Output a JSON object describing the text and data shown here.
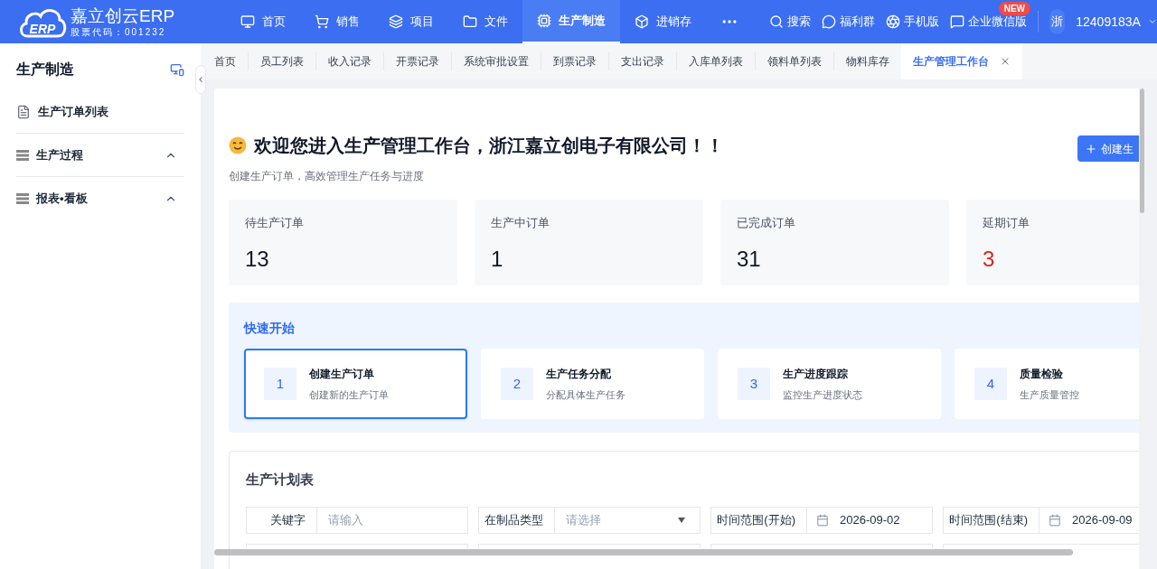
{
  "logo": {
    "mark": "ERP",
    "name": "嘉立创云ERP",
    "stock_code": "股票代码：001232"
  },
  "nav": [
    {
      "label": "首页",
      "selected": false
    },
    {
      "label": "销售",
      "selected": false
    },
    {
      "label": "项目",
      "selected": false
    },
    {
      "label": "文件",
      "selected": false
    },
    {
      "label": "生产制造",
      "selected": true
    },
    {
      "label": "进销存",
      "selected": false
    }
  ],
  "header_actions": [
    {
      "label": "搜索"
    },
    {
      "label": "福利群"
    },
    {
      "label": "手机版"
    },
    {
      "label": "企业微信版",
      "badge": "NEW"
    }
  ],
  "user": {
    "avatar": "浙",
    "account": "12409183A"
  },
  "sidebar": {
    "title": "生产制造",
    "items": [
      {
        "label": "生产订单列表",
        "kind": "link"
      },
      {
        "label": "生产过程",
        "kind": "group"
      },
      {
        "label": "报表•看板",
        "kind": "group"
      }
    ]
  },
  "tabs": [
    {
      "label": "首页",
      "selected": false
    },
    {
      "label": "员工列表",
      "selected": false
    },
    {
      "label": "收入记录",
      "selected": false
    },
    {
      "label": "开票记录",
      "selected": false
    },
    {
      "label": "系统审批设置",
      "selected": false
    },
    {
      "label": "到票记录",
      "selected": false
    },
    {
      "label": "支出记录",
      "selected": false
    },
    {
      "label": "入库单列表",
      "selected": false
    },
    {
      "label": "领料单列表",
      "selected": false
    },
    {
      "label": "物料库存",
      "selected": false
    },
    {
      "label": "生产管理工作台",
      "selected": true
    }
  ],
  "welcome": {
    "title": "欢迎您进入生产管理工作台，浙江嘉立创电子有限公司！！",
    "subtitle": "创建生产订单，高效管理生产任务与进度",
    "button": "创建生"
  },
  "stats": [
    {
      "label": "待生产订单",
      "value": "13",
      "alert": false
    },
    {
      "label": "生产中订单",
      "value": "1",
      "alert": false
    },
    {
      "label": "已完成订单",
      "value": "31",
      "alert": false
    },
    {
      "label": "延期订单",
      "value": "3",
      "alert": true
    }
  ],
  "quick_start": {
    "title": "快速开始",
    "steps": [
      {
        "number": "1",
        "title": "创建生产订单",
        "desc": "创建新的生产订单",
        "selected": true
      },
      {
        "number": "2",
        "title": "生产任务分配",
        "desc": "分配具体生产任务",
        "selected": false
      },
      {
        "number": "3",
        "title": "生产进度跟踪",
        "desc": "监控生产进度状态",
        "selected": false
      },
      {
        "number": "4",
        "title": "质量检验",
        "desc": "生产质量管控",
        "selected": false
      }
    ]
  },
  "plan_table": {
    "title": "生产计划表",
    "filters": [
      {
        "label": "关键字",
        "kind": "text",
        "placeholder": "请输入"
      },
      {
        "label": "在制品类型",
        "kind": "select",
        "placeholder": "请选择"
      },
      {
        "label": "时间范围(开始)",
        "kind": "date",
        "value": "2026-09-02"
      },
      {
        "label": "时间范围(结束)",
        "kind": "date",
        "value": "2026-09-09"
      }
    ]
  }
}
